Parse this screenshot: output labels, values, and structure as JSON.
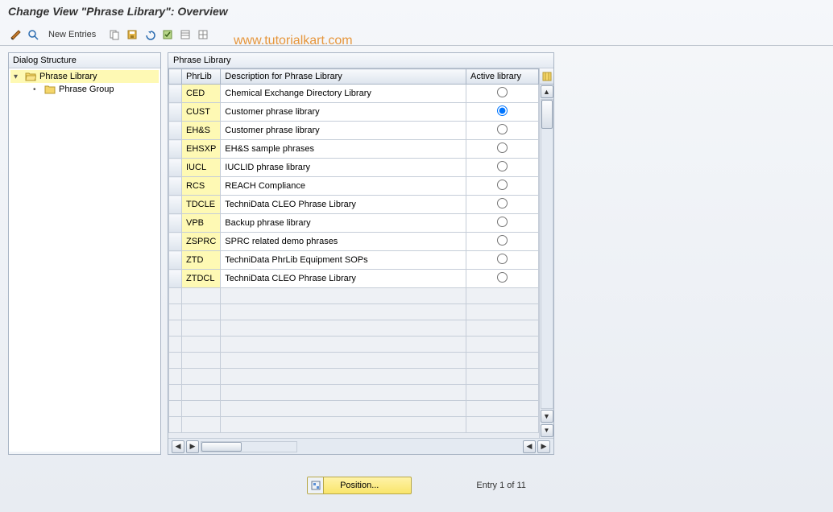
{
  "title": "Change View \"Phrase Library\": Overview",
  "watermark": "www.tutorialkart.com",
  "toolbar": {
    "new_entries": "New Entries"
  },
  "tree": {
    "header": "Dialog Structure",
    "root": "Phrase Library",
    "child": "Phrase Group"
  },
  "table": {
    "caption": "Phrase Library",
    "columns": {
      "code": "PhrLib",
      "desc": "Description for Phrase Library",
      "active": "Active library"
    },
    "rows": [
      {
        "code": "CED",
        "desc": "Chemical Exchange Directory Library",
        "active": false
      },
      {
        "code": "CUST",
        "desc": "Customer phrase library",
        "active": true
      },
      {
        "code": "EH&S",
        "desc": "Customer phrase library",
        "active": false
      },
      {
        "code": "EHSXP",
        "desc": "EH&S sample phrases",
        "active": false
      },
      {
        "code": "IUCL",
        "desc": "IUCLID phrase library",
        "active": false
      },
      {
        "code": "RCS",
        "desc": "REACH Compliance",
        "active": false
      },
      {
        "code": "TDCLE",
        "desc": "TechniData CLEO Phrase Library",
        "active": false
      },
      {
        "code": "VPB",
        "desc": "Backup phrase library",
        "active": false
      },
      {
        "code": "ZSPRC",
        "desc": "SPRC related demo phrases",
        "active": false
      },
      {
        "code": "ZTD",
        "desc": "TechniData PhrLib Equipment SOPs",
        "active": false
      },
      {
        "code": "ZTDCL",
        "desc": "TechniData CLEO Phrase Library",
        "active": false
      }
    ]
  },
  "footer": {
    "position_btn": "Position...",
    "entry_text": "Entry 1 of 11"
  }
}
